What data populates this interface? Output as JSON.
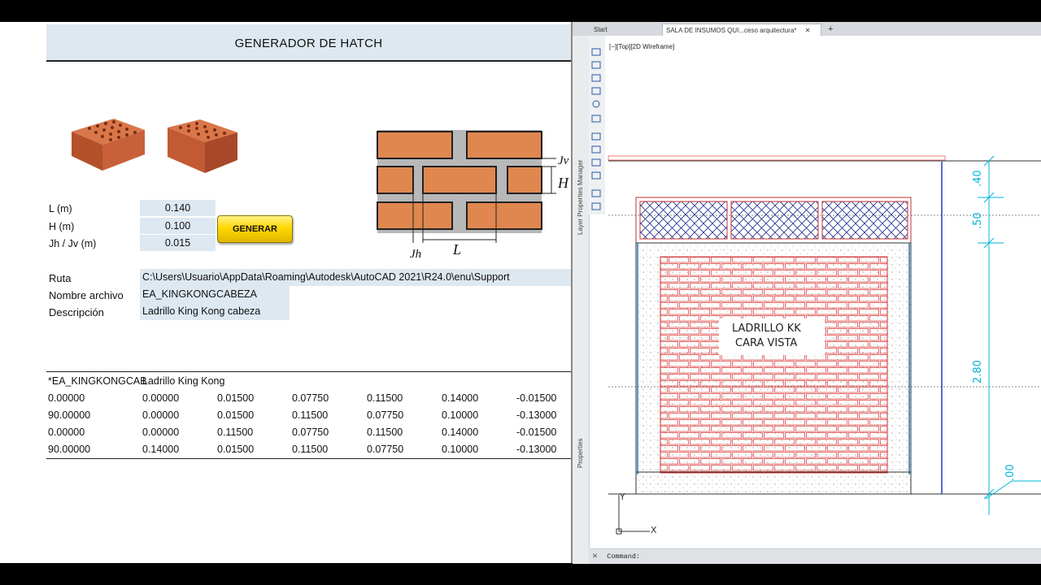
{
  "sheet": {
    "title": "GENERADOR DE HATCH",
    "params": [
      {
        "label": "L (m)",
        "value": "0.140"
      },
      {
        "label": "H (m)",
        "value": "0.100"
      },
      {
        "label": "Jh / Jv (m)",
        "value": "0.015"
      }
    ],
    "generate_label": "GENERAR",
    "diagram_labels": {
      "jv": "Jv",
      "h": "H",
      "jh": "Jh",
      "l": "L"
    },
    "fields": [
      {
        "label": "Ruta",
        "value": "C:\\Users\\Usuario\\AppData\\Roaming\\Autodesk\\AutoCAD 2021\\R24.0\\enu\\Support"
      },
      {
        "label": "Nombre archivo",
        "value": "EA_KINGKONGCABEZA"
      },
      {
        "label": "Descripción",
        "value": "Ladrillo King Kong cabeza"
      }
    ],
    "pattern": {
      "header": [
        "*EA_KINGKONGCAB",
        "Ladrillo King Kong"
      ],
      "rows": [
        [
          "0.00000",
          "0.00000",
          "0.01500",
          "0.07750",
          "0.11500",
          "0.14000",
          "-0.01500"
        ],
        [
          "90.00000",
          "0.00000",
          "0.01500",
          "0.11500",
          "0.07750",
          "0.10000",
          "-0.13000"
        ],
        [
          "0.00000",
          "0.00000",
          "0.11500",
          "0.07750",
          "0.11500",
          "0.14000",
          "-0.01500"
        ],
        [
          "90.00000",
          "0.14000",
          "0.01500",
          "0.11500",
          "0.07750",
          "0.10000",
          "-0.13000"
        ]
      ]
    }
  },
  "autocad": {
    "tabs": [
      {
        "label": "Start",
        "active": false
      },
      {
        "label": "SALA DE INSUMOS QUI...ceso arquitectura*",
        "active": true
      },
      {
        "label": "+",
        "active": false
      }
    ],
    "viewport_label": "[−][Top][2D Wireframe]",
    "palette_labels": [
      "Layer Properties Manager",
      "Properties"
    ],
    "drawing_text": [
      "LADRILLO  KK",
      "CARA  VISTA"
    ],
    "dimensions": [
      ".40",
      ".50",
      "2.80",
      ".00"
    ],
    "ucs": {
      "x": "X",
      "y": "Y"
    },
    "command_prompt": "Command:"
  },
  "colors": {
    "header_fill": "#dde8f1",
    "button_yellow": "#ffd800",
    "brick_orange": "#e0874f",
    "cad_red": "#d9534f",
    "cad_cyan": "#00b4d8",
    "cad_blue": "#1f3fbf"
  }
}
